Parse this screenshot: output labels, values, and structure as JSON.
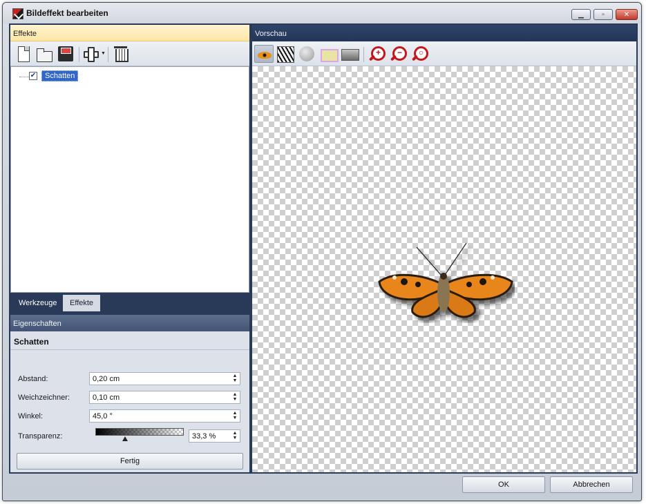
{
  "window": {
    "title": "Bildeffekt bearbeiten"
  },
  "effects_panel": {
    "header": "Effekte",
    "toolbar": [
      "document-new-icon",
      "folder-open-icon",
      "save-icon",
      "add-effect-icon",
      "trash-icon"
    ],
    "items": [
      {
        "label": "Schatten",
        "checked": true,
        "check_glyph": "✔"
      }
    ]
  },
  "tabs": [
    {
      "label": "Werkzeuge",
      "active": false
    },
    {
      "label": "Effekte",
      "active": true
    }
  ],
  "properties": {
    "header": "Eigenschaften",
    "title": "Schatten",
    "fields": [
      {
        "label": "Abstand:",
        "value": "0,20 cm"
      },
      {
        "label": "Weichzeichner:",
        "value": "0,10 cm"
      },
      {
        "label": "Winkel:",
        "value": "45,0 °"
      }
    ],
    "transparency": {
      "label": "Transparenz:",
      "value": "33,3 %",
      "fraction": 0.333
    },
    "done_label": "Fertig"
  },
  "preview": {
    "header": "Vorschau",
    "toolbar": [
      "butterfly-preview-icon",
      "zebra-pattern-icon",
      "circle-icon",
      "frame-icon",
      "photo-icon",
      "zoom-in-icon",
      "zoom-out-icon",
      "zoom-fit-icon"
    ],
    "zoom_glyphs": {
      "in": "+",
      "out": "−",
      "fit": "○"
    }
  },
  "footer": {
    "ok_label": "OK",
    "cancel_label": "Abbrechen"
  },
  "colors": {
    "frame": "#283a58",
    "selection": "#3165c8",
    "effects_header": "#fde7a6",
    "zoom_red": "#c2181d"
  }
}
